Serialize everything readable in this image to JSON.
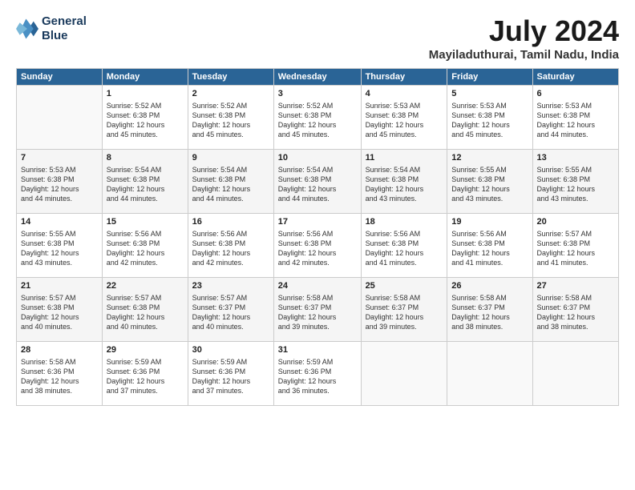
{
  "logo": {
    "line1": "General",
    "line2": "Blue"
  },
  "title": "July 2024",
  "subtitle": "Mayiladuthurai, Tamil Nadu, India",
  "weekdays": [
    "Sunday",
    "Monday",
    "Tuesday",
    "Wednesday",
    "Thursday",
    "Friday",
    "Saturday"
  ],
  "weeks": [
    [
      {
        "day": "",
        "info": ""
      },
      {
        "day": "1",
        "info": "Sunrise: 5:52 AM\nSunset: 6:38 PM\nDaylight: 12 hours\nand 45 minutes."
      },
      {
        "day": "2",
        "info": "Sunrise: 5:52 AM\nSunset: 6:38 PM\nDaylight: 12 hours\nand 45 minutes."
      },
      {
        "day": "3",
        "info": "Sunrise: 5:52 AM\nSunset: 6:38 PM\nDaylight: 12 hours\nand 45 minutes."
      },
      {
        "day": "4",
        "info": "Sunrise: 5:53 AM\nSunset: 6:38 PM\nDaylight: 12 hours\nand 45 minutes."
      },
      {
        "day": "5",
        "info": "Sunrise: 5:53 AM\nSunset: 6:38 PM\nDaylight: 12 hours\nand 45 minutes."
      },
      {
        "day": "6",
        "info": "Sunrise: 5:53 AM\nSunset: 6:38 PM\nDaylight: 12 hours\nand 44 minutes."
      }
    ],
    [
      {
        "day": "7",
        "info": "Sunrise: 5:53 AM\nSunset: 6:38 PM\nDaylight: 12 hours\nand 44 minutes."
      },
      {
        "day": "8",
        "info": "Sunrise: 5:54 AM\nSunset: 6:38 PM\nDaylight: 12 hours\nand 44 minutes."
      },
      {
        "day": "9",
        "info": "Sunrise: 5:54 AM\nSunset: 6:38 PM\nDaylight: 12 hours\nand 44 minutes."
      },
      {
        "day": "10",
        "info": "Sunrise: 5:54 AM\nSunset: 6:38 PM\nDaylight: 12 hours\nand 44 minutes."
      },
      {
        "day": "11",
        "info": "Sunrise: 5:54 AM\nSunset: 6:38 PM\nDaylight: 12 hours\nand 43 minutes."
      },
      {
        "day": "12",
        "info": "Sunrise: 5:55 AM\nSunset: 6:38 PM\nDaylight: 12 hours\nand 43 minutes."
      },
      {
        "day": "13",
        "info": "Sunrise: 5:55 AM\nSunset: 6:38 PM\nDaylight: 12 hours\nand 43 minutes."
      }
    ],
    [
      {
        "day": "14",
        "info": "Sunrise: 5:55 AM\nSunset: 6:38 PM\nDaylight: 12 hours\nand 43 minutes."
      },
      {
        "day": "15",
        "info": "Sunrise: 5:56 AM\nSunset: 6:38 PM\nDaylight: 12 hours\nand 42 minutes."
      },
      {
        "day": "16",
        "info": "Sunrise: 5:56 AM\nSunset: 6:38 PM\nDaylight: 12 hours\nand 42 minutes."
      },
      {
        "day": "17",
        "info": "Sunrise: 5:56 AM\nSunset: 6:38 PM\nDaylight: 12 hours\nand 42 minutes."
      },
      {
        "day": "18",
        "info": "Sunrise: 5:56 AM\nSunset: 6:38 PM\nDaylight: 12 hours\nand 41 minutes."
      },
      {
        "day": "19",
        "info": "Sunrise: 5:56 AM\nSunset: 6:38 PM\nDaylight: 12 hours\nand 41 minutes."
      },
      {
        "day": "20",
        "info": "Sunrise: 5:57 AM\nSunset: 6:38 PM\nDaylight: 12 hours\nand 41 minutes."
      }
    ],
    [
      {
        "day": "21",
        "info": "Sunrise: 5:57 AM\nSunset: 6:38 PM\nDaylight: 12 hours\nand 40 minutes."
      },
      {
        "day": "22",
        "info": "Sunrise: 5:57 AM\nSunset: 6:38 PM\nDaylight: 12 hours\nand 40 minutes."
      },
      {
        "day": "23",
        "info": "Sunrise: 5:57 AM\nSunset: 6:37 PM\nDaylight: 12 hours\nand 40 minutes."
      },
      {
        "day": "24",
        "info": "Sunrise: 5:58 AM\nSunset: 6:37 PM\nDaylight: 12 hours\nand 39 minutes."
      },
      {
        "day": "25",
        "info": "Sunrise: 5:58 AM\nSunset: 6:37 PM\nDaylight: 12 hours\nand 39 minutes."
      },
      {
        "day": "26",
        "info": "Sunrise: 5:58 AM\nSunset: 6:37 PM\nDaylight: 12 hours\nand 38 minutes."
      },
      {
        "day": "27",
        "info": "Sunrise: 5:58 AM\nSunset: 6:37 PM\nDaylight: 12 hours\nand 38 minutes."
      }
    ],
    [
      {
        "day": "28",
        "info": "Sunrise: 5:58 AM\nSunset: 6:36 PM\nDaylight: 12 hours\nand 38 minutes."
      },
      {
        "day": "29",
        "info": "Sunrise: 5:59 AM\nSunset: 6:36 PM\nDaylight: 12 hours\nand 37 minutes."
      },
      {
        "day": "30",
        "info": "Sunrise: 5:59 AM\nSunset: 6:36 PM\nDaylight: 12 hours\nand 37 minutes."
      },
      {
        "day": "31",
        "info": "Sunrise: 5:59 AM\nSunset: 6:36 PM\nDaylight: 12 hours\nand 36 minutes."
      },
      {
        "day": "",
        "info": ""
      },
      {
        "day": "",
        "info": ""
      },
      {
        "day": "",
        "info": ""
      }
    ]
  ]
}
